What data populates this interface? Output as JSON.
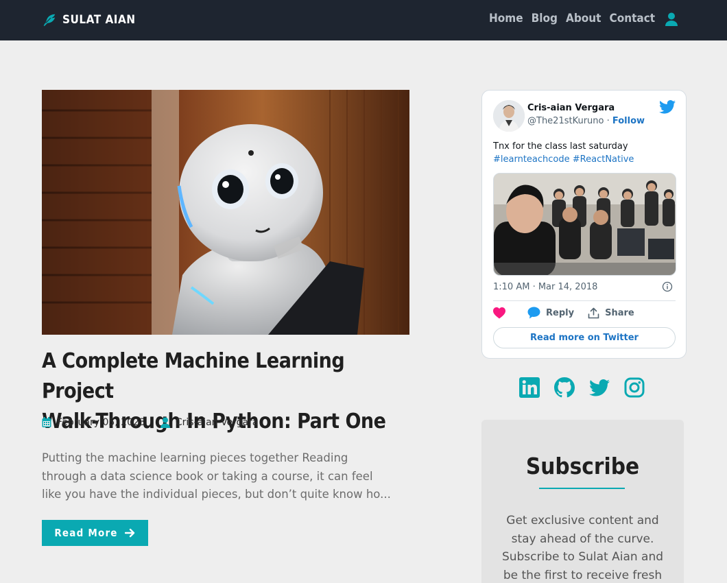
{
  "header": {
    "brand": "SULAT AIAN",
    "nav": [
      "Home",
      "Blog",
      "About",
      "Contact"
    ]
  },
  "post": {
    "title_line1": "A Complete Machine Learning Project",
    "title_line2": "Walk-Through In Python: Part One",
    "date": "February 05, 2023",
    "author": "Cris-aian Vergara",
    "excerpt_lines": [
      "Putting the machine learning pieces together Reading",
      "through a data science book or taking a course, it can feel",
      "like you have the individual pieces, but don’t quite know ho..."
    ],
    "read_more": "Read More"
  },
  "tweet": {
    "name": "Cris-aian Vergara",
    "handle": "@The21stKuruno",
    "separator": " · ",
    "follow": "Follow",
    "text": "Tnx for the class last saturday",
    "hashtags": [
      "#learnteachcode",
      "#ReactNative"
    ],
    "time": "1:10 AM · Mar 14, 2018",
    "reply": "Reply",
    "share": "Share",
    "read_more": "Read more on Twitter"
  },
  "socials": [
    "linkedin-icon",
    "github-icon",
    "twitter-icon",
    "instagram-icon"
  ],
  "subscribe": {
    "title": "Subscribe",
    "text_lines": [
      "Get exclusive content and",
      "stay ahead of the curve.",
      "Subscribe to Sulat Aian and",
      "be the first to receive fresh"
    ]
  },
  "colors": {
    "accent": "#0aa9b2",
    "header_bg": "#1e2530",
    "page_bg": "#eeeeee",
    "twitter_blue": "#1d9bf0",
    "heart": "#f91880"
  }
}
